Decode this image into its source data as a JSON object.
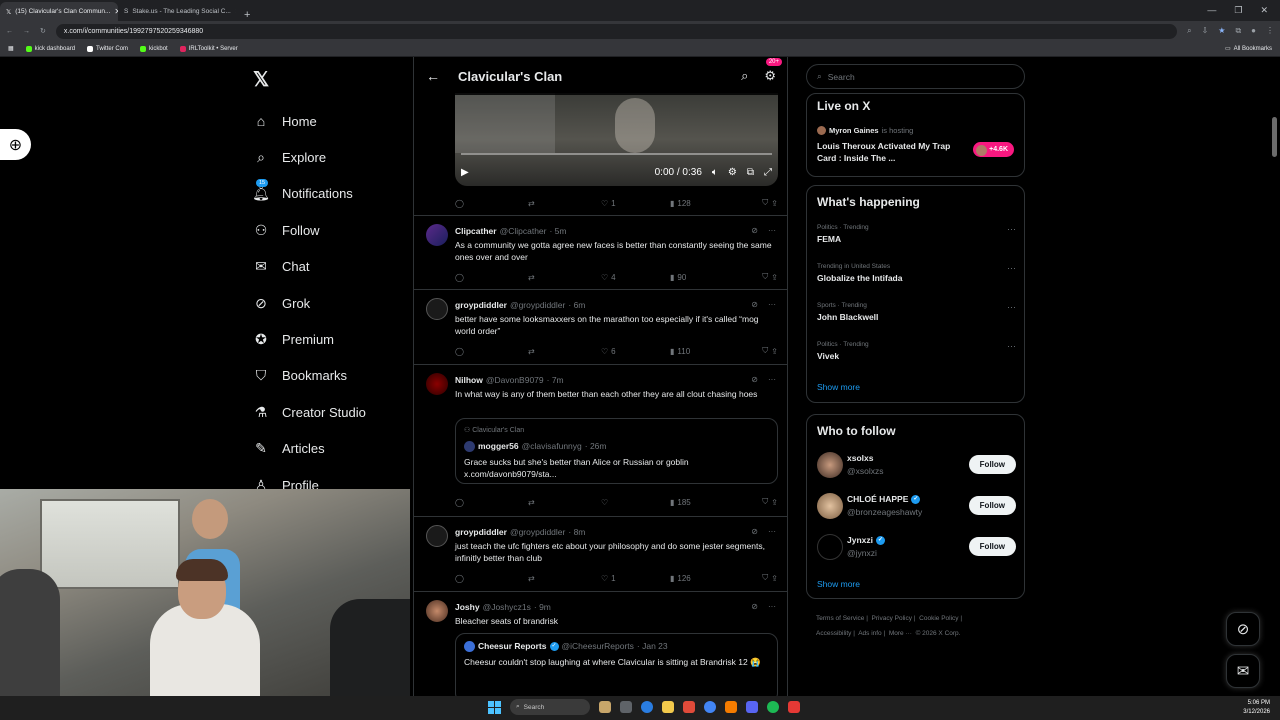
{
  "browser": {
    "tabs": [
      {
        "title": "(15) Clavicular's Clan Commun...",
        "active": true
      },
      {
        "title": "Stake.us - The Leading Social C...",
        "active": false
      }
    ],
    "url": "x.com/i/communities/1992797520259346880",
    "bookmarks": [
      "kick dashboard",
      "Twitter Com",
      "kickbot",
      "IRLToolkit • Server"
    ],
    "all_bookmarks": "All Bookmarks"
  },
  "nav": {
    "items": [
      "Home",
      "Explore",
      "Notifications",
      "Follow",
      "Chat",
      "Grok",
      "Premium",
      "Bookmarks",
      "Creator Studio",
      "Articles",
      "Profile"
    ],
    "notification_count": "15"
  },
  "feed": {
    "title": "Clavicular's Clan",
    "notif_badge": "20+",
    "video": {
      "time": "0:00 / 0:36"
    },
    "video_actions": {
      "likes": "1",
      "views": "128"
    },
    "posts": [
      {
        "name": "Clipcather",
        "handle": "@Clipcather",
        "time": "· 5m",
        "text": "As a community we gotta agree new faces is better than constantly seeing the same ones over and over",
        "likes": "4",
        "views": "90"
      },
      {
        "name": "groypdiddler",
        "handle": "@groypdiddler",
        "time": "· 6m",
        "text": "better have some looksmaxxers on the marathon too especially if it's called “mog world order”",
        "likes": "6",
        "views": "110"
      },
      {
        "name": "Nilhow",
        "handle": "@DavonB9079",
        "time": "· 7m",
        "text": "In what way is any of them better than each other they are all clout chasing hoes",
        "likes": "",
        "views": "185",
        "quote": {
          "community": "Clavicular's Clan",
          "name": "mogger56",
          "handle": "@clavisafunnyg",
          "time": "· 26m",
          "text": "Grace sucks but she's better than Alice or Russian or goblin",
          "link": "x.com/davonb9079/sta..."
        }
      },
      {
        "name": "groypdiddler",
        "handle": "@groypdiddler",
        "time": "· 8m",
        "text": "just teach the ufc fighters etc about your philosophy and do some jester segments, infinitly better than club",
        "likes": "1",
        "views": "126"
      },
      {
        "name": "Joshy",
        "handle": "@Joshycz1s",
        "time": "· 9m",
        "text": "Bleacher seats of brandrisk",
        "quote": {
          "name": "Cheesur Reports",
          "handle": "@iCheesurReports",
          "time": "· Jan 23",
          "text": "Cheesur couldn't stop laughing at where Clavicular is sitting at Brandrisk 12 😭"
        }
      }
    ]
  },
  "right": {
    "search_placeholder": "Search",
    "live": {
      "title": "Live on X",
      "host": "Myron Gaines",
      "hosting": "is hosting",
      "space_title": "Louis Theroux Activated My Trap Card : Inside The ...",
      "count": "+4.6K"
    },
    "happening": {
      "title": "What's happening",
      "trends": [
        {
          "context": "Politics · Trending",
          "name": "FEMA"
        },
        {
          "context": "Trending in United States",
          "name": "Globalize the Intifada"
        },
        {
          "context": "Sports · Trending",
          "name": "John Blackwell"
        },
        {
          "context": "Politics · Trending",
          "name": "Vivek"
        }
      ],
      "show_more": "Show more"
    },
    "who_to_follow": {
      "title": "Who to follow",
      "users": [
        {
          "name": "xsolxs",
          "handle": "@xsolxzs",
          "verified": false
        },
        {
          "name": "CHLOÉ HAPPE",
          "handle": "@bronzeageshawty",
          "verified": true
        },
        {
          "name": "Jynxzi",
          "handle": "@jynxzi",
          "verified": true
        }
      ],
      "follow_label": "Follow",
      "show_more": "Show more"
    },
    "footer": {
      "line1": [
        "Terms of Service",
        "|",
        "Privacy Policy",
        "|",
        "Cookie Policy",
        "|"
      ],
      "line2": [
        "Accessibility",
        "|",
        "Ads info",
        "|",
        "More ···",
        "© 2026 X Corp."
      ]
    }
  },
  "taskbar": {
    "search": "Search",
    "time": "5:06 PM",
    "date": "3/12/2026"
  }
}
